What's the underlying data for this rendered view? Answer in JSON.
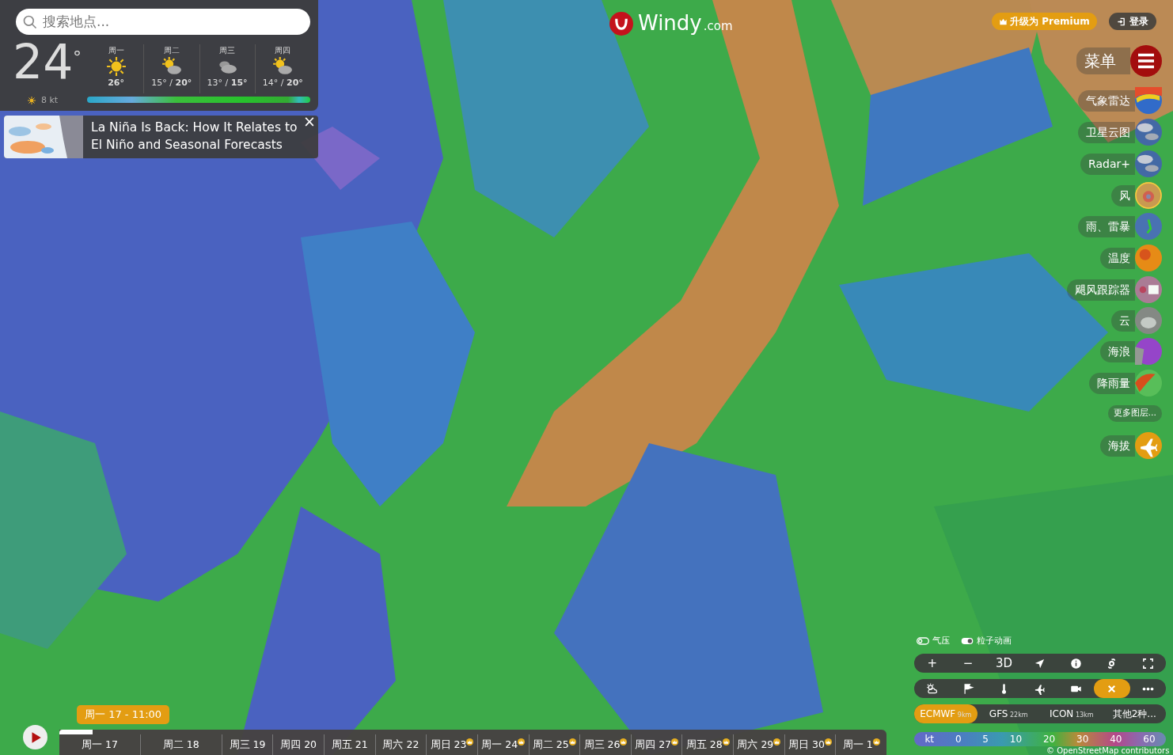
{
  "search": {
    "placeholder": "搜索地点..."
  },
  "current": {
    "temp": "24",
    "degree": "°",
    "wind": "8 kt"
  },
  "forecast": [
    {
      "day": "周一",
      "kind": "sun",
      "high": "26°"
    },
    {
      "day": "周二",
      "kind": "partly",
      "low": "15°",
      "sep": "/",
      "high": "20°"
    },
    {
      "day": "周三",
      "kind": "cloudy",
      "low": "13°",
      "sep": "/",
      "high": "15°"
    },
    {
      "day": "周四",
      "kind": "partly",
      "low": "14°",
      "sep": "/",
      "high": "20°"
    }
  ],
  "news": {
    "title": "La Niña Is Back: How It Relates to El Niño and Seasonal Forecasts",
    "close": "×"
  },
  "logo": {
    "name": "Windy",
    "suffix": ".com"
  },
  "premium": {
    "label": "升级为 Premium"
  },
  "login": {
    "label": "登录"
  },
  "menu": {
    "label": "菜单"
  },
  "layers": [
    {
      "label": "气象雷达",
      "kind": "radar",
      "selected": false
    },
    {
      "label": "卫星云图",
      "kind": "satellite",
      "selected": false
    },
    {
      "label": "Radar+",
      "kind": "satellite",
      "selected": false
    },
    {
      "label": "风",
      "kind": "wind",
      "selected": true
    },
    {
      "label": "雨、雷暴",
      "kind": "rain",
      "selected": false
    },
    {
      "label": "温度",
      "kind": "temp",
      "selected": false
    },
    {
      "label": "飓风跟踪器",
      "kind": "hurricane",
      "selected": false
    },
    {
      "label": "云",
      "kind": "cloud",
      "selected": false
    },
    {
      "label": "海浪",
      "kind": "waves",
      "selected": false
    },
    {
      "label": "降雨量",
      "kind": "precip",
      "selected": false
    }
  ],
  "more_layers": {
    "label": "更多图层..."
  },
  "altitude": {
    "label": "海拔"
  },
  "toggles": [
    {
      "label": "气压",
      "on": false
    },
    {
      "label": "粒子动画",
      "on": true
    }
  ],
  "toolbar": [
    {
      "kind": "text",
      "text": "+"
    },
    {
      "kind": "text",
      "text": "−"
    },
    {
      "kind": "text",
      "text": "3D"
    },
    {
      "kind": "locate"
    },
    {
      "kind": "info"
    },
    {
      "kind": "hurricane"
    },
    {
      "kind": "fullscreen"
    }
  ],
  "toolbar2": [
    {
      "kind": "weather",
      "selected": false
    },
    {
      "kind": "flag",
      "selected": false
    },
    {
      "kind": "thermometer",
      "selected": false
    },
    {
      "kind": "plane",
      "selected": false
    },
    {
      "kind": "camera",
      "selected": false
    },
    {
      "kind": "close",
      "selected": true
    },
    {
      "kind": "more",
      "selected": false
    }
  ],
  "models": [
    {
      "name": "ECMWF",
      "res": "9km",
      "selected": true
    },
    {
      "name": "GFS",
      "res": "22km",
      "selected": false
    },
    {
      "name": "ICON",
      "res": "13km",
      "selected": false
    },
    {
      "name": "其他2种...",
      "selected": false
    }
  ],
  "scale": {
    "unit": "kt",
    "values": [
      "0",
      "5",
      "10",
      "20",
      "30",
      "40",
      "60"
    ]
  },
  "attribution": "© OpenStreetMap contributors",
  "timeline": {
    "bubble": "周一 17 - 11:00",
    "level": 0.04,
    "days": [
      {
        "label": "周一 17",
        "premium": false
      },
      {
        "label": "周二 18",
        "premium": false
      },
      {
        "label": "周三 19",
        "premium": false
      },
      {
        "label": "周四 20",
        "premium": false
      },
      {
        "label": "周五 21",
        "premium": false
      },
      {
        "label": "周六 22",
        "premium": false
      },
      {
        "label": "周日 23",
        "premium": true
      },
      {
        "label": "周一 24",
        "premium": true
      },
      {
        "label": "周二 25",
        "premium": true
      },
      {
        "label": "周三 26",
        "premium": true
      },
      {
        "label": "周四 27",
        "premium": true
      },
      {
        "label": "周五 28",
        "premium": true
      },
      {
        "label": "周六 29",
        "premium": true
      },
      {
        "label": "周日 30",
        "premium": true
      },
      {
        "label": "周一 1",
        "premium": true
      }
    ]
  }
}
